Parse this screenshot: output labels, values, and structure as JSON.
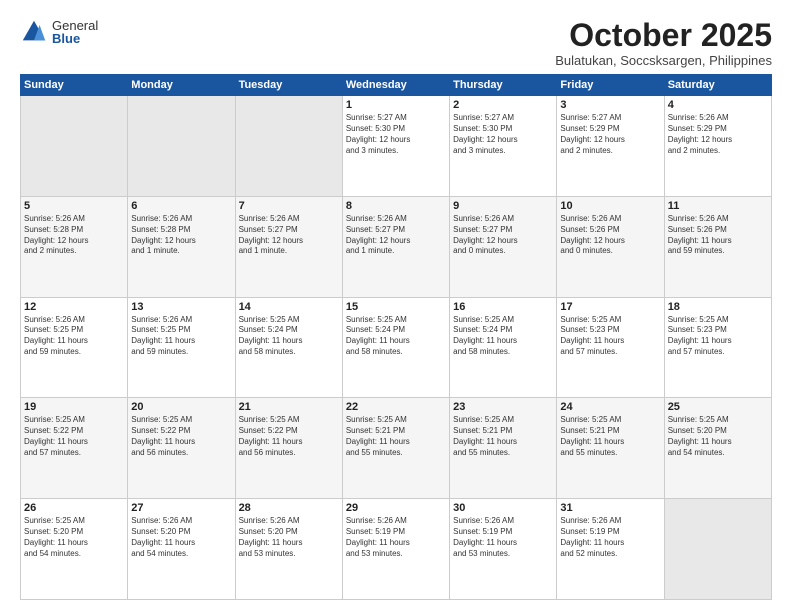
{
  "logo": {
    "general": "General",
    "blue": "Blue"
  },
  "title": "October 2025",
  "subtitle": "Bulatukan, Soccsksargen, Philippines",
  "weekdays": [
    "Sunday",
    "Monday",
    "Tuesday",
    "Wednesday",
    "Thursday",
    "Friday",
    "Saturday"
  ],
  "weeks": [
    [
      {
        "day": "",
        "info": ""
      },
      {
        "day": "",
        "info": ""
      },
      {
        "day": "",
        "info": ""
      },
      {
        "day": "1",
        "info": "Sunrise: 5:27 AM\nSunset: 5:30 PM\nDaylight: 12 hours\nand 3 minutes."
      },
      {
        "day": "2",
        "info": "Sunrise: 5:27 AM\nSunset: 5:30 PM\nDaylight: 12 hours\nand 3 minutes."
      },
      {
        "day": "3",
        "info": "Sunrise: 5:27 AM\nSunset: 5:29 PM\nDaylight: 12 hours\nand 2 minutes."
      },
      {
        "day": "4",
        "info": "Sunrise: 5:26 AM\nSunset: 5:29 PM\nDaylight: 12 hours\nand 2 minutes."
      }
    ],
    [
      {
        "day": "5",
        "info": "Sunrise: 5:26 AM\nSunset: 5:28 PM\nDaylight: 12 hours\nand 2 minutes."
      },
      {
        "day": "6",
        "info": "Sunrise: 5:26 AM\nSunset: 5:28 PM\nDaylight: 12 hours\nand 1 minute."
      },
      {
        "day": "7",
        "info": "Sunrise: 5:26 AM\nSunset: 5:27 PM\nDaylight: 12 hours\nand 1 minute."
      },
      {
        "day": "8",
        "info": "Sunrise: 5:26 AM\nSunset: 5:27 PM\nDaylight: 12 hours\nand 1 minute."
      },
      {
        "day": "9",
        "info": "Sunrise: 5:26 AM\nSunset: 5:27 PM\nDaylight: 12 hours\nand 0 minutes."
      },
      {
        "day": "10",
        "info": "Sunrise: 5:26 AM\nSunset: 5:26 PM\nDaylight: 12 hours\nand 0 minutes."
      },
      {
        "day": "11",
        "info": "Sunrise: 5:26 AM\nSunset: 5:26 PM\nDaylight: 11 hours\nand 59 minutes."
      }
    ],
    [
      {
        "day": "12",
        "info": "Sunrise: 5:26 AM\nSunset: 5:25 PM\nDaylight: 11 hours\nand 59 minutes."
      },
      {
        "day": "13",
        "info": "Sunrise: 5:26 AM\nSunset: 5:25 PM\nDaylight: 11 hours\nand 59 minutes."
      },
      {
        "day": "14",
        "info": "Sunrise: 5:25 AM\nSunset: 5:24 PM\nDaylight: 11 hours\nand 58 minutes."
      },
      {
        "day": "15",
        "info": "Sunrise: 5:25 AM\nSunset: 5:24 PM\nDaylight: 11 hours\nand 58 minutes."
      },
      {
        "day": "16",
        "info": "Sunrise: 5:25 AM\nSunset: 5:24 PM\nDaylight: 11 hours\nand 58 minutes."
      },
      {
        "day": "17",
        "info": "Sunrise: 5:25 AM\nSunset: 5:23 PM\nDaylight: 11 hours\nand 57 minutes."
      },
      {
        "day": "18",
        "info": "Sunrise: 5:25 AM\nSunset: 5:23 PM\nDaylight: 11 hours\nand 57 minutes."
      }
    ],
    [
      {
        "day": "19",
        "info": "Sunrise: 5:25 AM\nSunset: 5:22 PM\nDaylight: 11 hours\nand 57 minutes."
      },
      {
        "day": "20",
        "info": "Sunrise: 5:25 AM\nSunset: 5:22 PM\nDaylight: 11 hours\nand 56 minutes."
      },
      {
        "day": "21",
        "info": "Sunrise: 5:25 AM\nSunset: 5:22 PM\nDaylight: 11 hours\nand 56 minutes."
      },
      {
        "day": "22",
        "info": "Sunrise: 5:25 AM\nSunset: 5:21 PM\nDaylight: 11 hours\nand 55 minutes."
      },
      {
        "day": "23",
        "info": "Sunrise: 5:25 AM\nSunset: 5:21 PM\nDaylight: 11 hours\nand 55 minutes."
      },
      {
        "day": "24",
        "info": "Sunrise: 5:25 AM\nSunset: 5:21 PM\nDaylight: 11 hours\nand 55 minutes."
      },
      {
        "day": "25",
        "info": "Sunrise: 5:25 AM\nSunset: 5:20 PM\nDaylight: 11 hours\nand 54 minutes."
      }
    ],
    [
      {
        "day": "26",
        "info": "Sunrise: 5:25 AM\nSunset: 5:20 PM\nDaylight: 11 hours\nand 54 minutes."
      },
      {
        "day": "27",
        "info": "Sunrise: 5:26 AM\nSunset: 5:20 PM\nDaylight: 11 hours\nand 54 minutes."
      },
      {
        "day": "28",
        "info": "Sunrise: 5:26 AM\nSunset: 5:20 PM\nDaylight: 11 hours\nand 53 minutes."
      },
      {
        "day": "29",
        "info": "Sunrise: 5:26 AM\nSunset: 5:19 PM\nDaylight: 11 hours\nand 53 minutes."
      },
      {
        "day": "30",
        "info": "Sunrise: 5:26 AM\nSunset: 5:19 PM\nDaylight: 11 hours\nand 53 minutes."
      },
      {
        "day": "31",
        "info": "Sunrise: 5:26 AM\nSunset: 5:19 PM\nDaylight: 11 hours\nand 52 minutes."
      },
      {
        "day": "",
        "info": ""
      }
    ]
  ]
}
